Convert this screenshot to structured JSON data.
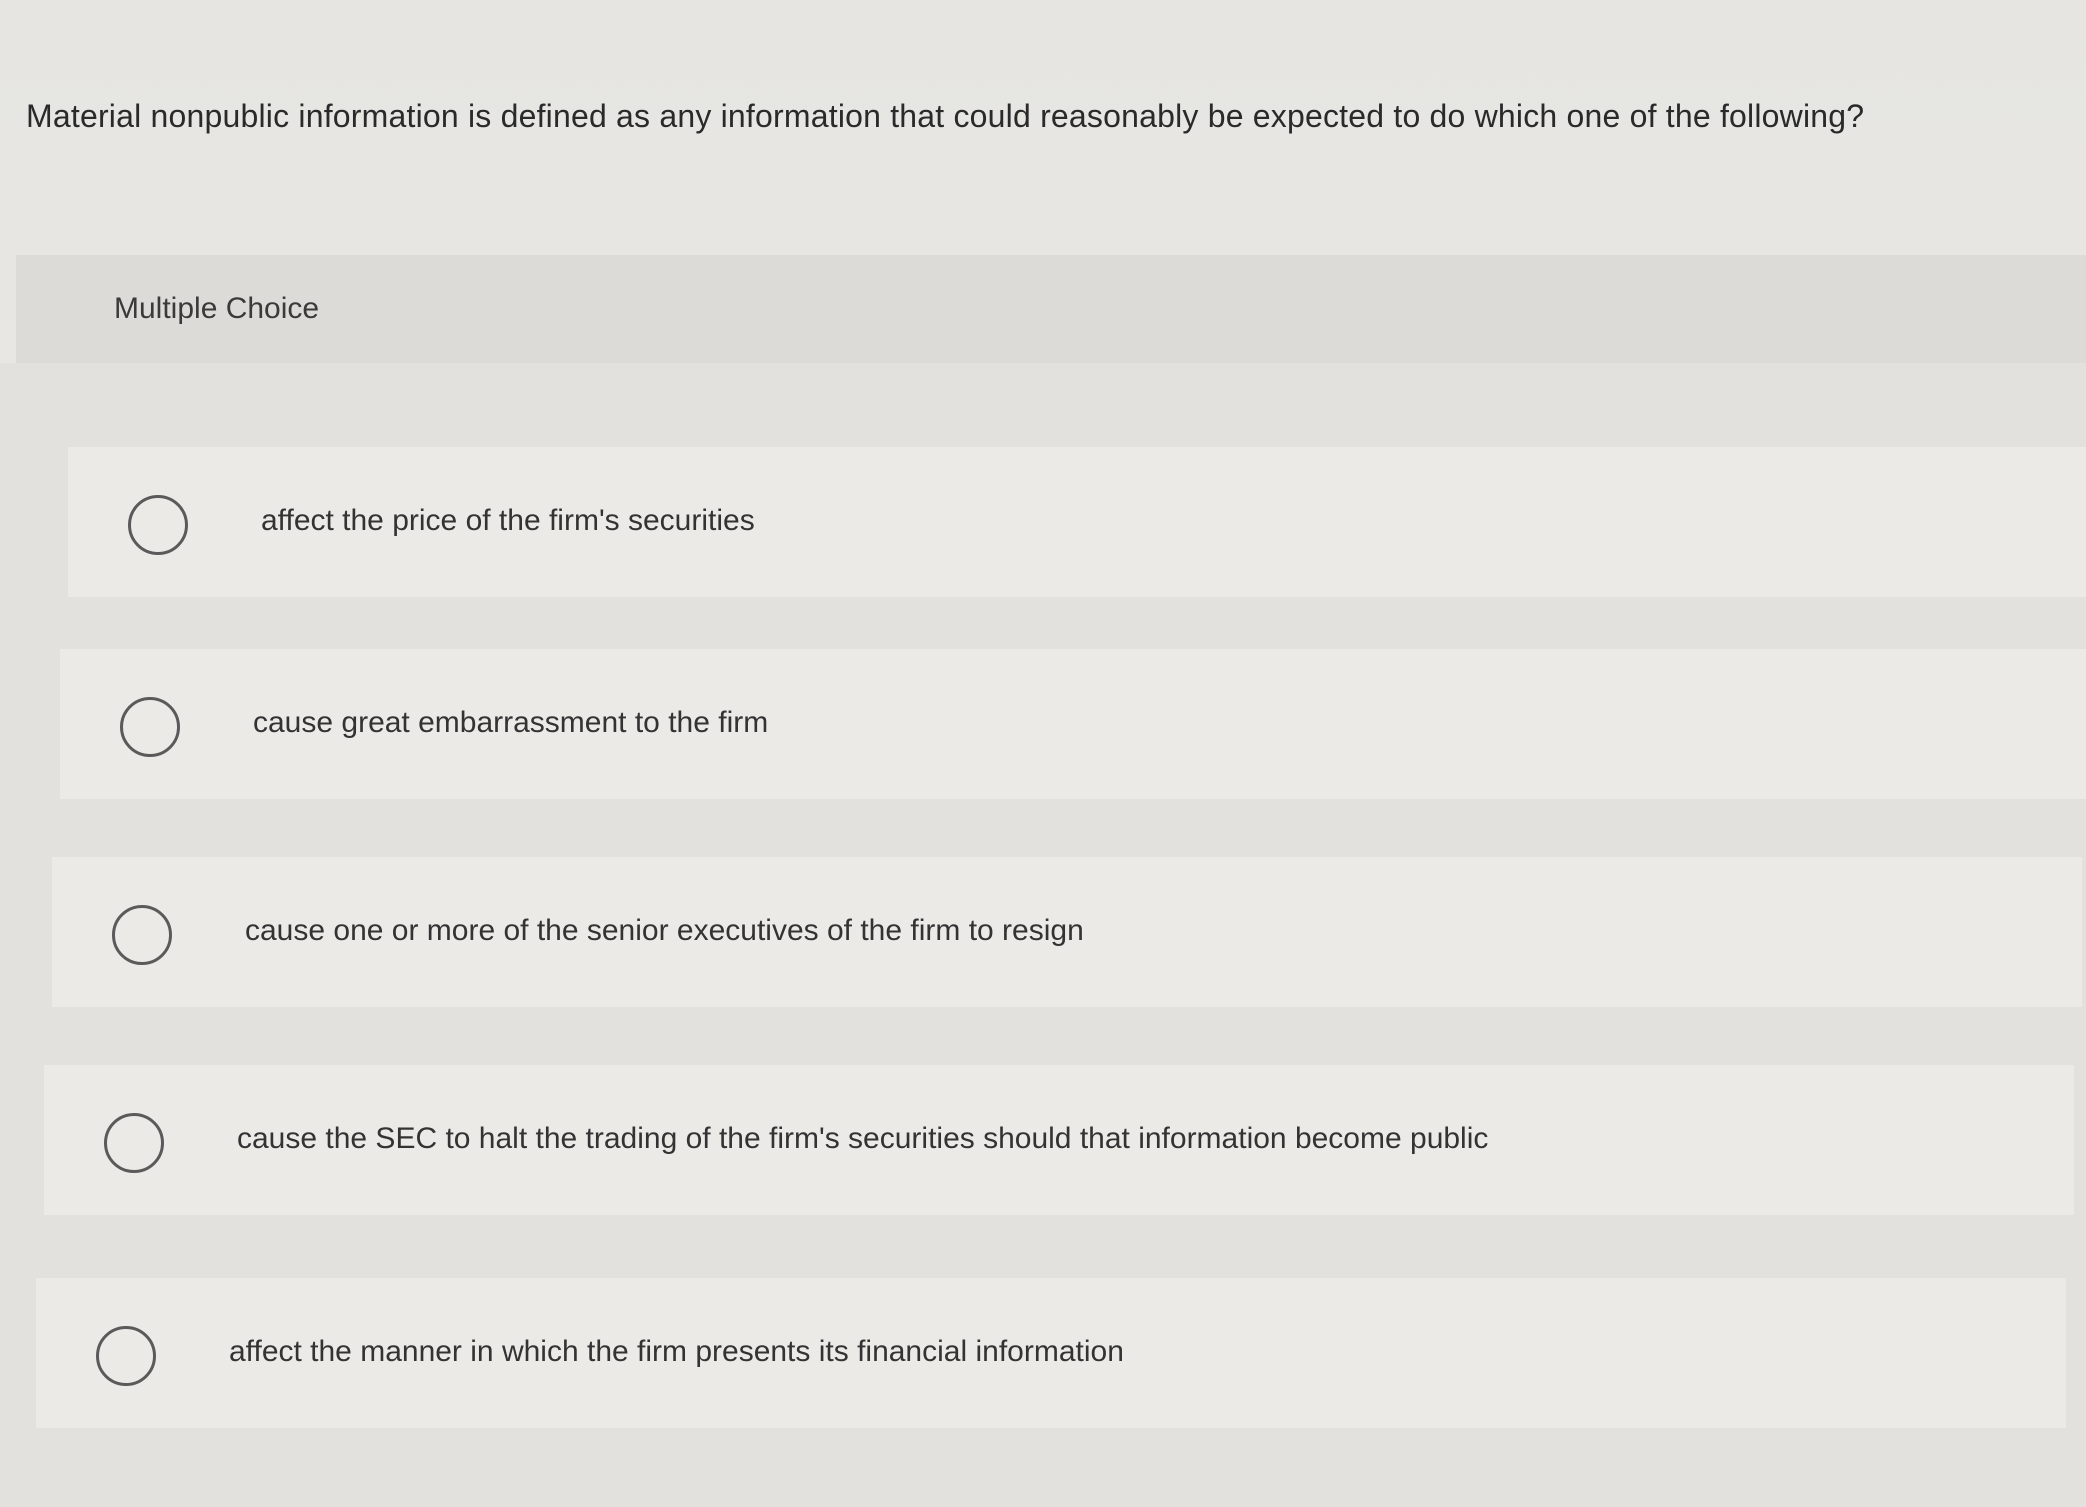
{
  "question": {
    "text": "Material nonpublic information is defined as any information that could reasonably be expected to do which one of the following?"
  },
  "section": {
    "label": "Multiple Choice"
  },
  "choices": [
    {
      "text": "affect the price of the firm's securities"
    },
    {
      "text": "cause great embarrassment to the firm"
    },
    {
      "text": "cause one or more of the senior executives of the firm to resign"
    },
    {
      "text": "cause the SEC to halt the trading of the firm's securities should that information become public"
    },
    {
      "text": "affect the manner in which the firm presents its financial information"
    }
  ],
  "colors": {
    "background": "#e6e5e1",
    "header_band": "#dcdbd7",
    "choice_bg": "#ebeae6",
    "text": "#2b2b2b",
    "radio_border": "#5a5a5a"
  }
}
